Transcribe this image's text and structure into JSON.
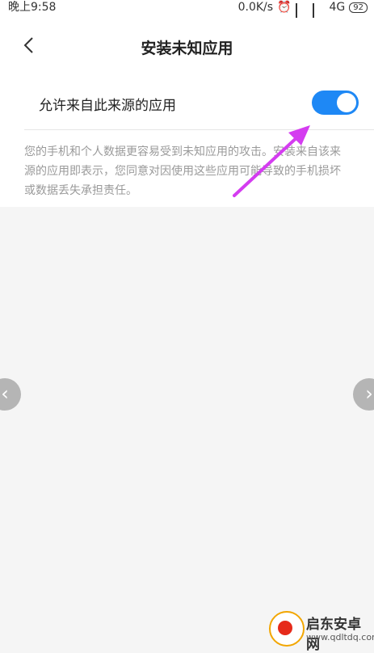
{
  "status_bar": {
    "time": "晚上9:58",
    "speed": "0.0K/s",
    "network": "4G",
    "battery": "92"
  },
  "header": {
    "title": "安装未知应用"
  },
  "setting": {
    "label": "允许来自此来源的应用",
    "enabled": true,
    "accent_color": "#1e88f5",
    "description": "您的手机和个人数据更容易受到未知应用的攻击。安装来自该来源的应用即表示，您同意对因使用这些应用可能导致的手机损坏或数据丢失承担责任。"
  },
  "annotation": {
    "arrow_color": "#d43cf0"
  },
  "watermark": {
    "name": "启东安卓网",
    "url": "www.qdltdq.com"
  }
}
